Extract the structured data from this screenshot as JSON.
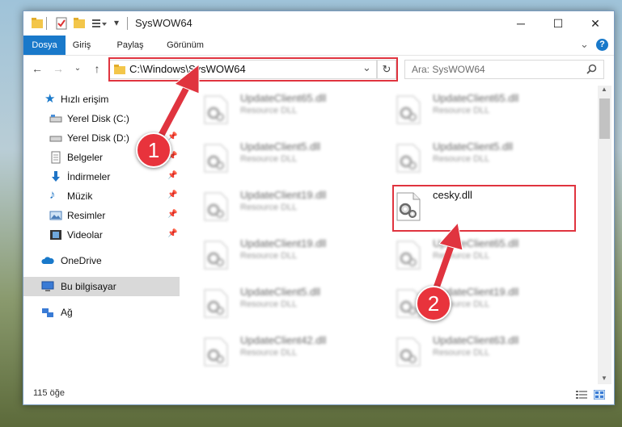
{
  "window": {
    "title": "SysWOW64",
    "minimize": "─",
    "maximize": "☐",
    "close": "✕"
  },
  "ribbon": {
    "tabs": [
      "Dosya",
      "Giriş",
      "Paylaş",
      "Görünüm"
    ],
    "collapse": "⌄",
    "help": "?"
  },
  "address": {
    "path": "C:\\Windows\\SysWOW64",
    "dropdown": "⌄",
    "refresh": "↻",
    "search_placeholder": "Ara: SysWOW64"
  },
  "sidebar": {
    "items": [
      {
        "label": "Hızlı erişim",
        "icon": "star-icon"
      },
      {
        "label": "Yerel Disk (C:)",
        "icon": "drive-icon",
        "pinned": true
      },
      {
        "label": "Yerel Disk (D:)",
        "icon": "drive-icon",
        "pinned": true
      },
      {
        "label": "Belgeler",
        "icon": "document-icon",
        "pinned": true
      },
      {
        "label": "İndirmeler",
        "icon": "download-icon",
        "pinned": true
      },
      {
        "label": "Müzik",
        "icon": "music-icon",
        "pinned": true
      },
      {
        "label": "Resimler",
        "icon": "pictures-icon",
        "pinned": true
      },
      {
        "label": "Videolar",
        "icon": "video-icon",
        "pinned": true
      },
      {
        "label": "OneDrive",
        "icon": "cloud-icon"
      },
      {
        "label": "Bu bilgisayar",
        "icon": "computer-icon",
        "selected": true
      },
      {
        "label": "Ağ",
        "icon": "network-icon"
      }
    ]
  },
  "files": [
    {
      "name": "UpdateClient65.dll",
      "type": "Resource DLL"
    },
    {
      "name": "UpdateClient65.dll",
      "type": "Resource DLL"
    },
    {
      "name": "UpdateClient5.dll",
      "type": "Resource DLL"
    },
    {
      "name": "UpdateClient5.dll",
      "type": "Resource DLL"
    },
    {
      "name": "UpdateClient19.dll",
      "type": "Resource DLL"
    },
    {
      "name": "cesky.dll",
      "type": ""
    },
    {
      "name": "UpdateClient19.dll",
      "type": "Resource DLL"
    },
    {
      "name": "UpdateClient65.dll",
      "type": "Resource DLL"
    },
    {
      "name": "UpdateClient5.dll",
      "type": "Resource DLL"
    },
    {
      "name": "UpdateClient19.dll",
      "type": "Resource DLL"
    },
    {
      "name": "UpdateClient42.dll",
      "type": "Resource DLL"
    },
    {
      "name": "UpdateClient63.dll",
      "type": "Resource DLL"
    }
  ],
  "status": {
    "count": "115 öğe"
  },
  "annotations": {
    "step1": "1",
    "step2": "2",
    "color": "#e0343f"
  }
}
